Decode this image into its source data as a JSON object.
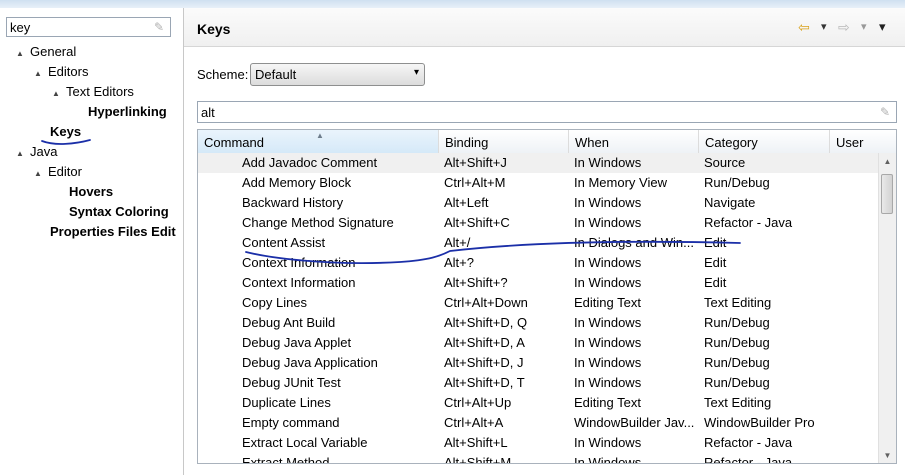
{
  "left_panel": {
    "filter": {
      "value": "key",
      "placeholder": ""
    },
    "tree": [
      {
        "label": "General",
        "expander": "▲"
      },
      {
        "label": "Editors",
        "expander": "▲"
      },
      {
        "label": "Text Editors",
        "expander": "▲"
      },
      {
        "label": "Hyperlinking",
        "expander": ""
      },
      {
        "label": "Keys",
        "expander": ""
      },
      {
        "label": "Java",
        "expander": "▲"
      },
      {
        "label": "Editor",
        "expander": "▲"
      },
      {
        "label": "Hovers",
        "expander": ""
      },
      {
        "label": "Syntax Coloring",
        "expander": ""
      },
      {
        "label": "Properties Files Edit",
        "expander": ""
      }
    ]
  },
  "header": {
    "title": "Keys",
    "back_icon": "⇦",
    "back_dropdown": "▾",
    "forward_icon": "⇨",
    "forward_dropdown": "▾",
    "menu_dropdown": "▾"
  },
  "scheme": {
    "label": "Scheme:",
    "value": "Default",
    "arrow": "▾"
  },
  "search": {
    "value": "alt",
    "placeholder": ""
  },
  "table": {
    "columns": [
      "Command",
      "Binding",
      "When",
      "Category",
      "User"
    ],
    "sort_indicator": "▲",
    "rows": [
      {
        "command": "Add Javadoc Comment",
        "binding": "Alt+Shift+J",
        "when": "In Windows",
        "category": "Source",
        "user": ""
      },
      {
        "command": "Add Memory Block",
        "binding": "Ctrl+Alt+M",
        "when": "In Memory View",
        "category": "Run/Debug",
        "user": ""
      },
      {
        "command": "Backward History",
        "binding": "Alt+Left",
        "when": "In Windows",
        "category": "Navigate",
        "user": ""
      },
      {
        "command": "Change Method Signature",
        "binding": "Alt+Shift+C",
        "when": "In Windows",
        "category": "Refactor - Java",
        "user": ""
      },
      {
        "command": "Content Assist",
        "binding": "Alt+/",
        "when": "In Dialogs and Win...",
        "category": "Edit",
        "user": ""
      },
      {
        "command": "Context Information",
        "binding": "Alt+?",
        "when": "In Windows",
        "category": "Edit",
        "user": ""
      },
      {
        "command": "Context Information",
        "binding": "Alt+Shift+?",
        "when": "In Windows",
        "category": "Edit",
        "user": ""
      },
      {
        "command": "Copy Lines",
        "binding": "Ctrl+Alt+Down",
        "when": "Editing Text",
        "category": "Text Editing",
        "user": ""
      },
      {
        "command": "Debug Ant Build",
        "binding": "Alt+Shift+D, Q",
        "when": "In Windows",
        "category": "Run/Debug",
        "user": ""
      },
      {
        "command": "Debug Java Applet",
        "binding": "Alt+Shift+D, A",
        "when": "In Windows",
        "category": "Run/Debug",
        "user": ""
      },
      {
        "command": "Debug Java Application",
        "binding": "Alt+Shift+D, J",
        "when": "In Windows",
        "category": "Run/Debug",
        "user": ""
      },
      {
        "command": "Debug JUnit Test",
        "binding": "Alt+Shift+D, T",
        "when": "In Windows",
        "category": "Run/Debug",
        "user": ""
      },
      {
        "command": "Duplicate Lines",
        "binding": "Ctrl+Alt+Up",
        "when": "Editing Text",
        "category": "Text Editing",
        "user": ""
      },
      {
        "command": "Empty command",
        "binding": "Ctrl+Alt+A",
        "when": "WindowBuilder Jav...",
        "category": "WindowBuilder Pro",
        "user": ""
      },
      {
        "command": "Extract Local Variable",
        "binding": "Alt+Shift+L",
        "when": "In Windows",
        "category": "Refactor - Java",
        "user": ""
      },
      {
        "command": "Extract Method",
        "binding": "Alt+Shift+M",
        "when": "In Windows",
        "category": "Refactor - Java",
        "user": ""
      }
    ]
  },
  "scrollbar": {
    "up_arrow": "▲",
    "down_arrow": "▼"
  },
  "colors": {
    "annotation_ink": "#1b2fa8",
    "selected_row": "#f0f0f0",
    "back_icon": "#d9a21b"
  }
}
